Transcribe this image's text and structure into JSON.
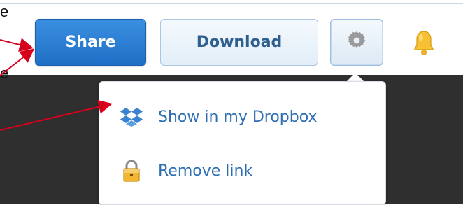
{
  "annotations": {
    "fragment_1": "e",
    "fragment_2": "e"
  },
  "toolbar": {
    "share_label": "Share",
    "download_label": "Download",
    "settings_icon": "gear-icon",
    "notifications_icon": "bell-icon"
  },
  "menu": {
    "items": [
      {
        "label": "Show in my Dropbox",
        "icon": "dropbox-icon"
      },
      {
        "label": "Remove link",
        "icon": "lock-icon"
      }
    ]
  },
  "colors": {
    "share_button": "#1f6fc6",
    "link_text": "#2f6fb1",
    "annotation_arrow": "#d6001c",
    "background_dark": "#2f2f2f"
  }
}
